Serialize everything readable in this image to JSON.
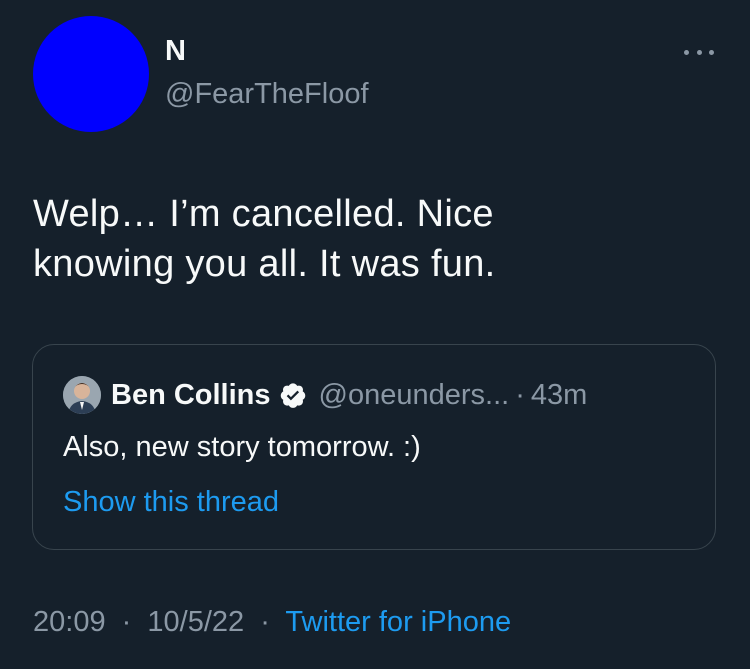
{
  "tweet": {
    "author": {
      "name": "N",
      "handle": "@FearTheFloof",
      "avatar_color": "#0000ff"
    },
    "more_icon": "more-horizontal-icon",
    "text_line1": "Welp… I’m cancelled. Nice",
    "text_line2": "knowing you all. It was fun.",
    "quoted": {
      "name": "Ben Collins",
      "verified_icon": "verified-badge-icon",
      "handle": "@oneunders...",
      "dot": "·",
      "time": "43m",
      "text": "Also, new story tomorrow. :)",
      "show_thread": "Show this thread"
    },
    "meta": {
      "time": "20:09",
      "sep1": "·",
      "date": "10/5/22",
      "sep2": "·",
      "source": "Twitter for iPhone"
    }
  },
  "colors": {
    "background": "#15202b",
    "primary_text": "#f7f9f9",
    "secondary_text": "#8b98a5",
    "accent": "#1d9bf0",
    "border": "#38444d"
  }
}
